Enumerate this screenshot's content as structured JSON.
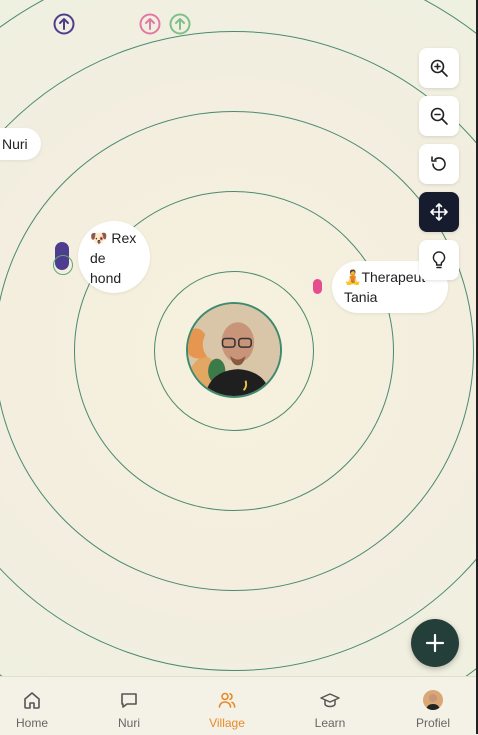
{
  "map": {
    "bubbles": {
      "nuri": "Nuri",
      "rex_emoji": "🐶",
      "rex_line1": "Rex",
      "rex_line2": "de",
      "rex_line3": "hond",
      "tania_emoji": "🧘",
      "tania_line1": "Therapeut",
      "tania_line2": "Tania"
    },
    "colors": {
      "ring": "#4a8a70",
      "purple": "#4e3d8f",
      "pink": "#e64d8e",
      "green": "#5ea67a",
      "accent": "#e88a2a"
    }
  },
  "controls": [
    "zoom-in-icon",
    "zoom-out-icon",
    "reset-icon",
    "move-icon",
    "lightbulb-icon"
  ],
  "fab": "plus-icon",
  "nav": {
    "items": [
      {
        "label": "Home",
        "icon": "home-icon"
      },
      {
        "label": "Nuri",
        "icon": "chat-icon"
      },
      {
        "label": "Village",
        "icon": "users-icon",
        "active": true
      },
      {
        "label": "Learn",
        "icon": "graduation-cap-icon"
      },
      {
        "label": "Profiel",
        "icon": "avatar"
      }
    ]
  }
}
